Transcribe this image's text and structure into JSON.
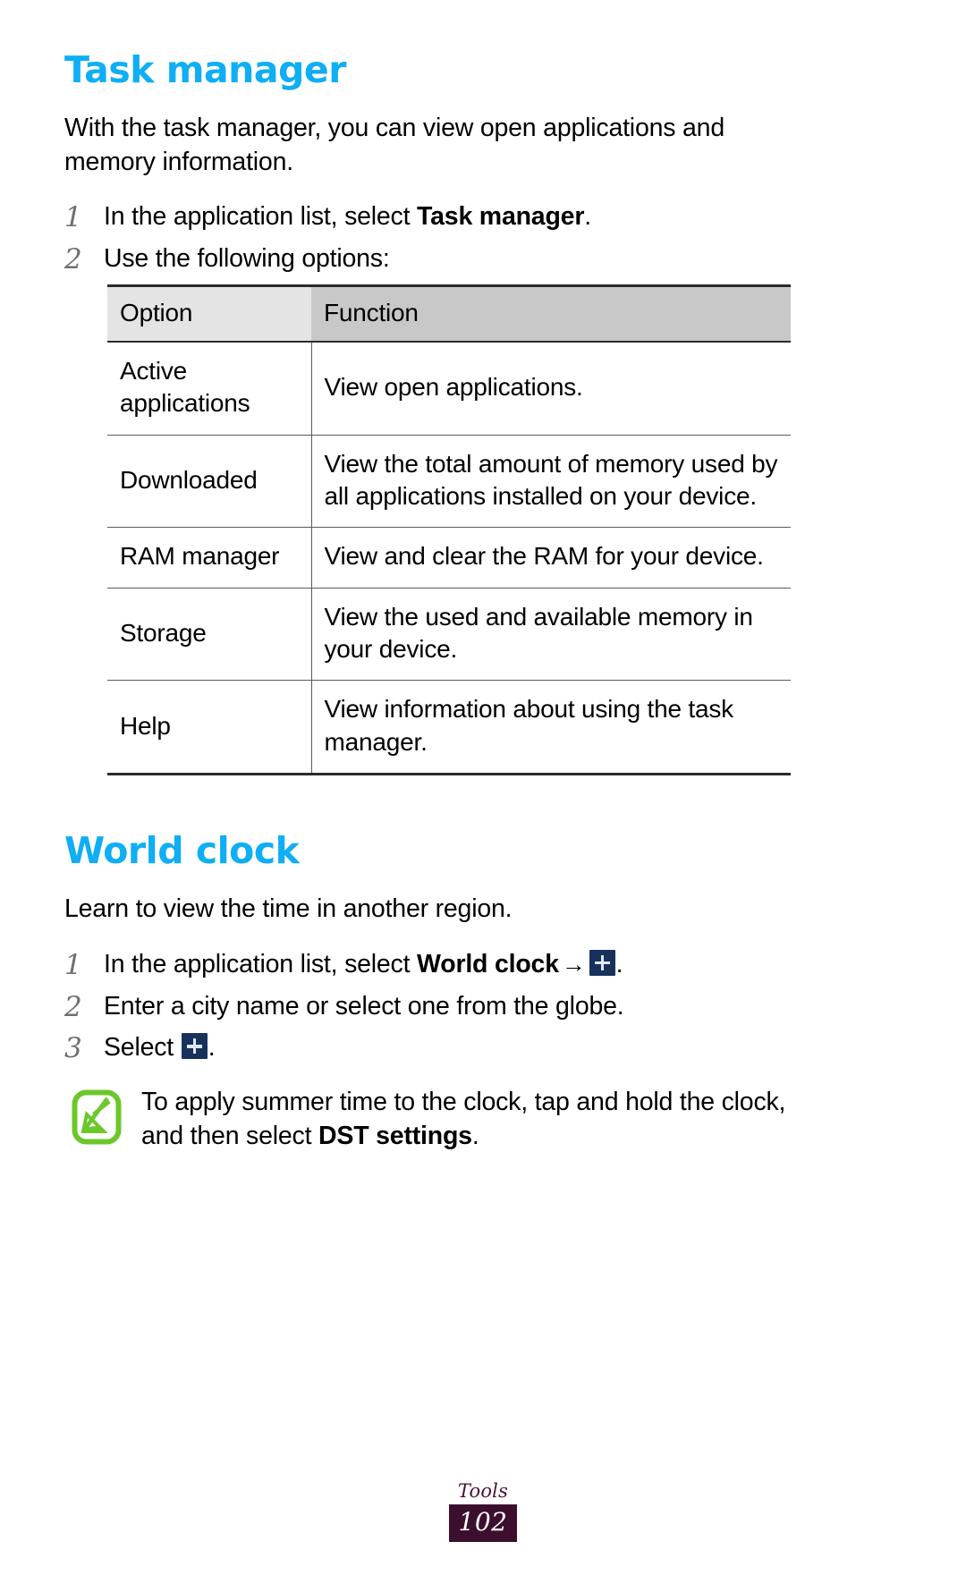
{
  "theme": {
    "heading_color": "#0FAEF5",
    "note_icon_color": "#6CC72B",
    "plus_icon_bg": "#17315C",
    "footer_color": "#3D0F2E"
  },
  "sections": [
    {
      "id": "task-manager",
      "title": "Task manager",
      "lead": "With the task manager, you can view open applications and memory information.",
      "steps": [
        {
          "num": "1",
          "pre": "In the application list, select ",
          "bold": "Task manager",
          "post": "."
        },
        {
          "num": "2",
          "pre": "Use the following options:",
          "bold": "",
          "post": ""
        }
      ],
      "table": {
        "headers": [
          "Option",
          "Function"
        ],
        "rows": [
          {
            "option": "Active applications",
            "function": "View open applications."
          },
          {
            "option": "Downloaded",
            "function": "View the total amount of memory used by all applications installed on your device."
          },
          {
            "option": "RAM manager",
            "function": "View and clear the RAM for your device."
          },
          {
            "option": "Storage",
            "function": "View the used and available memory in your device."
          },
          {
            "option": "Help",
            "function": "View information about using the task manager."
          }
        ]
      }
    },
    {
      "id": "world-clock",
      "title": "World clock",
      "lead": "Learn to view the time in another region.",
      "steps": [
        {
          "num": "1",
          "pre": "In the application list, select ",
          "bold": "World clock",
          "arrow": "→",
          "icon": "plus-icon",
          "post": "."
        },
        {
          "num": "2",
          "pre": "Enter a city name or select one from the globe.",
          "bold": "",
          "post": ""
        },
        {
          "num": "3",
          "pre": "Select ",
          "icon": "plus-icon",
          "post": "."
        }
      ],
      "note": {
        "icon": "note-pencil-icon",
        "pre": "To apply summer time to the clock, tap and hold the clock, and then select ",
        "bold": "DST settings",
        "post": "."
      }
    }
  ],
  "footer": {
    "label": "Tools",
    "page": "102"
  }
}
